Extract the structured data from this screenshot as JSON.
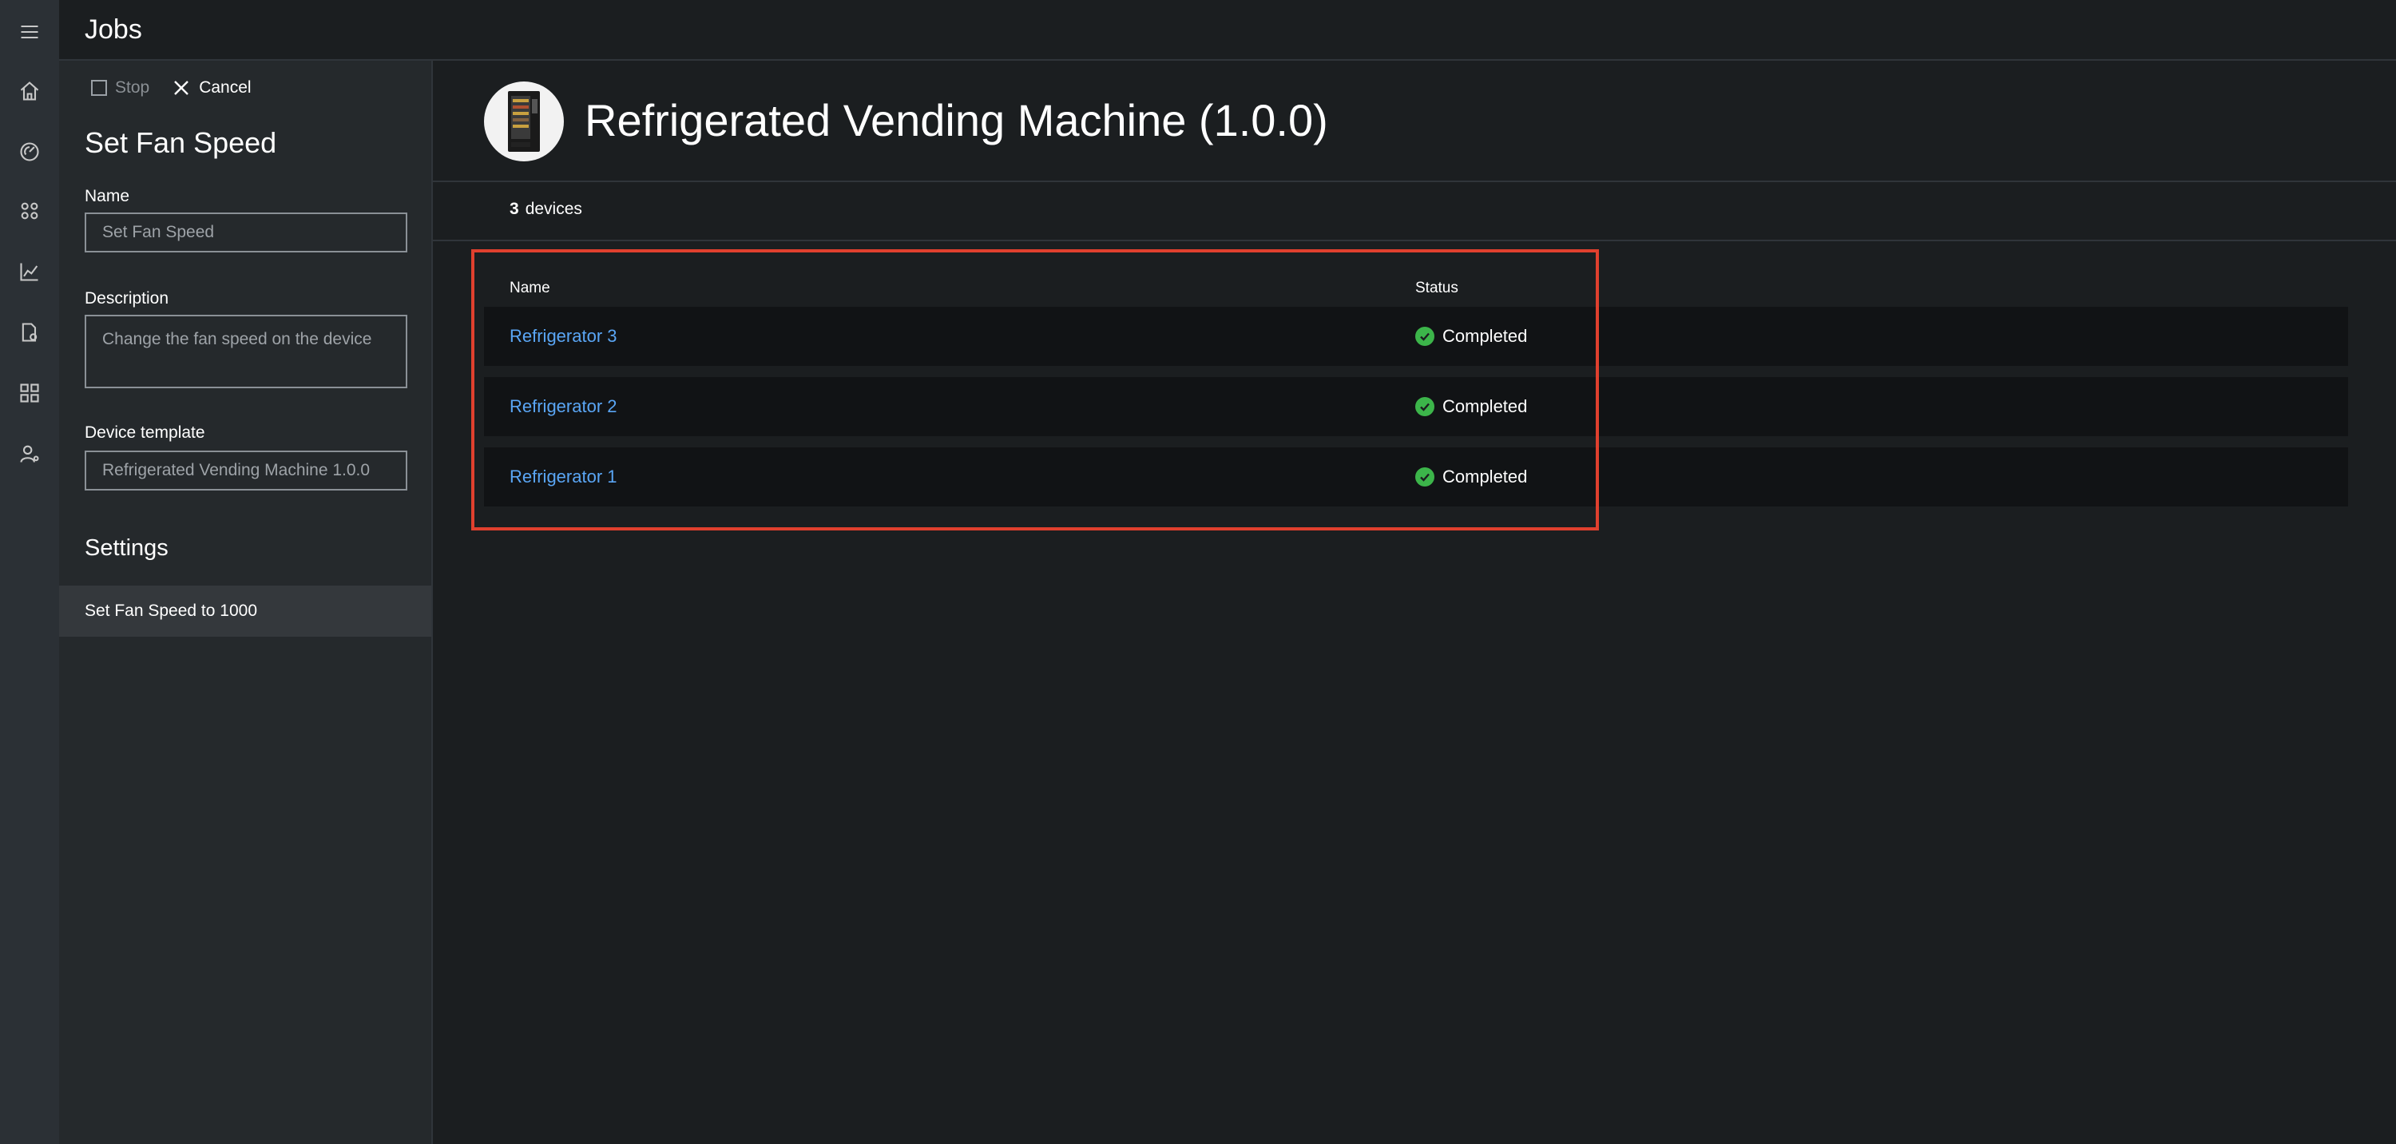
{
  "header": {
    "title": "Jobs"
  },
  "rail": {
    "icons": [
      "menu-icon",
      "home-icon",
      "dashboard-icon",
      "devices-icon",
      "analytics-icon",
      "device-template-icon",
      "apps-icon",
      "user-icon"
    ]
  },
  "job": {
    "stop_label": "Stop",
    "cancel_label": "Cancel",
    "title": "Set Fan Speed",
    "name_label": "Name",
    "name_value": "Set Fan Speed",
    "description_label": "Description",
    "description_value": "Change the fan speed on the device",
    "template_label": "Device template",
    "template_value": "Refrigerated Vending Machine 1.0.0",
    "settings_title": "Settings",
    "settings_items": [
      "Set Fan Speed to 1000"
    ]
  },
  "main": {
    "device_title": "Refrigerated Vending Machine (1.0.0)",
    "device_count": "3",
    "device_count_suffix": "devices",
    "columns": {
      "name": "Name",
      "status": "Status"
    },
    "rows": [
      {
        "name": "Refrigerator 3",
        "status": "Completed"
      },
      {
        "name": "Refrigerator 2",
        "status": "Completed"
      },
      {
        "name": "Refrigerator 1",
        "status": "Completed"
      }
    ]
  },
  "colors": {
    "accent_link": "#5aa6f5",
    "status_success": "#3cb54a",
    "highlight_border": "#e0402e",
    "background": "#1b1e20"
  }
}
